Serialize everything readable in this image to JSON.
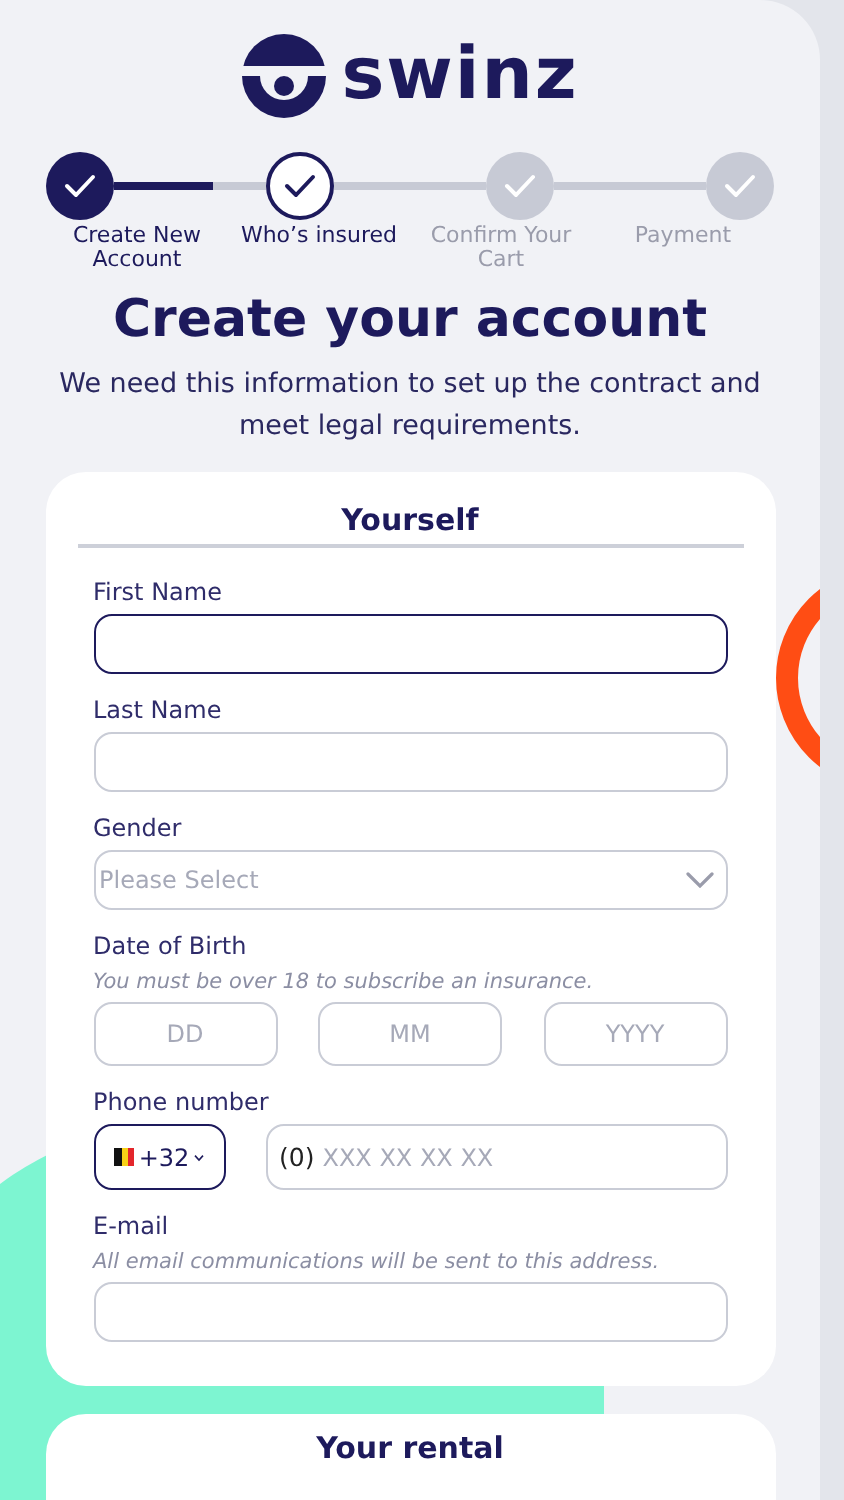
{
  "logo": {
    "text": "swinz"
  },
  "steps": [
    {
      "label": "Create New Account",
      "completed": true,
      "selected": false
    },
    {
      "label": "Who’s insured",
      "completed": false,
      "selected": true
    },
    {
      "label": "Confirm Your Cart",
      "completed": false,
      "selected": false
    },
    {
      "label": "Payment",
      "completed": false,
      "selected": false
    }
  ],
  "title": "Create your account",
  "subtitle": "We need this information to set up the contract and meet legal requirements.",
  "form": {
    "heading": "Yourself",
    "fields": [
      {
        "kind": "text",
        "label": "First Name",
        "focused": true
      },
      {
        "kind": "text",
        "label": "Last Name",
        "focused": false
      },
      {
        "kind": "select",
        "label": "Gender",
        "placeholder": "Please Select"
      },
      {
        "kind": "date",
        "label": "Date of Birth",
        "hint": "You must be over 18 to subscribe an insurance.",
        "parts": [
          {
            "placeholder": "DD"
          },
          {
            "placeholder": "MM"
          },
          {
            "placeholder": "YYYY"
          }
        ]
      },
      {
        "kind": "phone",
        "label": "Phone number",
        "country_code": "+32",
        "prefix": "(0)",
        "placeholder": "XXX XX XX XX"
      },
      {
        "kind": "text",
        "label": "E-mail",
        "hint": "All email communications will be sent to this address.",
        "focused": false
      }
    ]
  },
  "next_section": {
    "heading": "Your rental"
  }
}
